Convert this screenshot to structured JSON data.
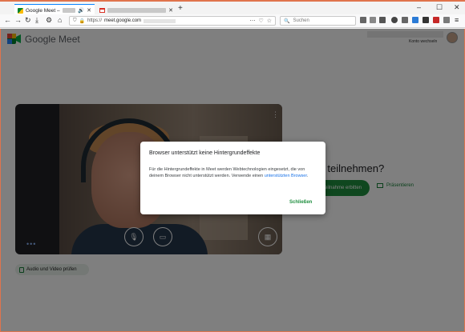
{
  "browser": {
    "active_tab_title": "Google Meet –",
    "second_tab_title": "",
    "new_tab": "+",
    "window_controls": {
      "minimize": "–",
      "maximize": "☐",
      "close": "✕"
    },
    "url_scheme": "https://",
    "url_host": "meet.google.com",
    "search_placeholder": "Suchen"
  },
  "meet": {
    "logo_text": "Google Meet",
    "account_switch": "Konto wechseln",
    "join_heading": "chtest du teilnehmen?",
    "join_button": "Teilnahme erbitten",
    "present_button": "Präsentieren",
    "av_check": "Audio und Video prüfen"
  },
  "dialog": {
    "title": "Browser unterstützt keine Hintergrundeffekte",
    "body": "Für die Hintergrundeffekte in Meet werden Webtechnologien eingesetzt, die von deinem Browser nicht unterstützt werden. Verwende einen ",
    "link": "unterstützten Browser",
    "body_end": ".",
    "close_button": "Schließen"
  },
  "colors": {
    "accent_green": "#1e8e3e",
    "window_border": "#e0744c",
    "link_blue": "#1a73e8"
  }
}
